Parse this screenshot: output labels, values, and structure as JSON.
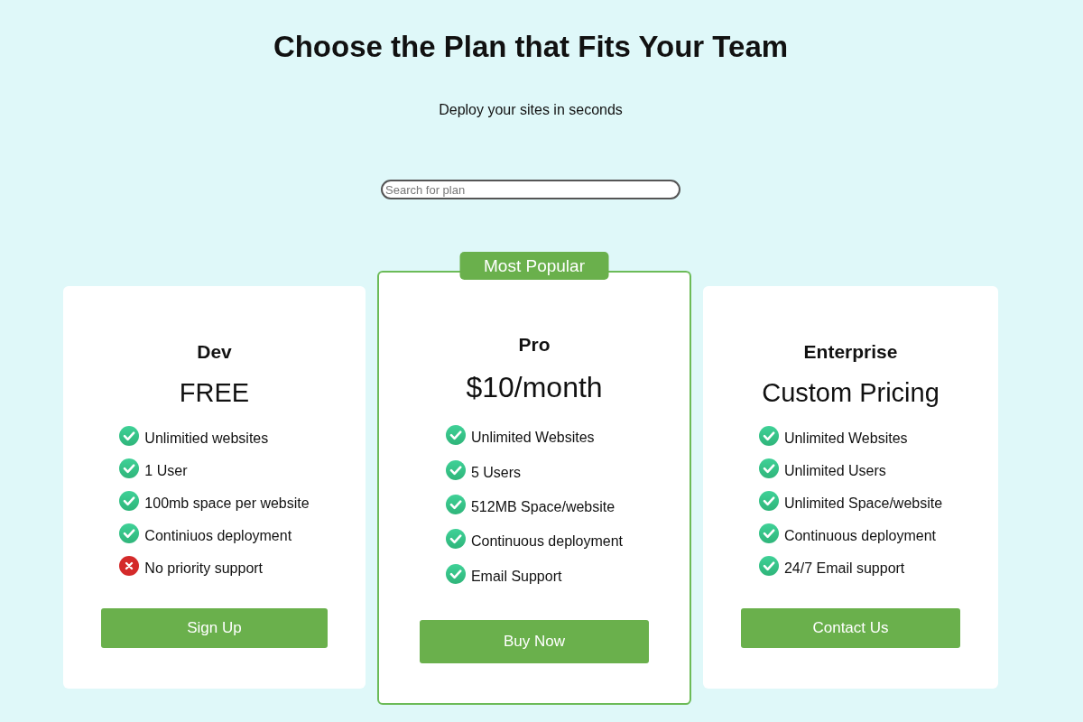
{
  "header": {
    "title": "Choose the Plan that Fits Your Team",
    "subtitle": "Deploy your sites in seconds"
  },
  "search": {
    "placeholder": "Search for plan"
  },
  "plans": [
    {
      "name": "Dev",
      "price": "FREE",
      "featured": false,
      "features": [
        {
          "text": "Unlimitied websites",
          "included": true
        },
        {
          "text": "1 User",
          "included": true
        },
        {
          "text": "100mb space per website",
          "included": true
        },
        {
          "text": "Continiuos deployment",
          "included": true
        },
        {
          "text": "No priority support",
          "included": false
        }
      ],
      "button": "Sign Up"
    },
    {
      "name": "Pro",
      "price": "$10/month",
      "featured": true,
      "badge": "Most Popular",
      "features": [
        {
          "text": "Unlimited Websites",
          "included": true
        },
        {
          "text": "5 Users",
          "included": true
        },
        {
          "text": "512MB Space/website",
          "included": true
        },
        {
          "text": "Continuous deployment",
          "included": true
        },
        {
          "text": "Email Support",
          "included": true
        }
      ],
      "button": "Buy Now"
    },
    {
      "name": "Enterprise",
      "price": "Custom Pricing",
      "featured": false,
      "features": [
        {
          "text": "Unlimited Websites",
          "included": true
        },
        {
          "text": "Unlimited Users",
          "included": true
        },
        {
          "text": "Unlimited Space/website",
          "included": true
        },
        {
          "text": "Continuous deployment",
          "included": true
        },
        {
          "text": "24/7 Email support",
          "included": true
        }
      ],
      "button": "Contact Us"
    }
  ]
}
